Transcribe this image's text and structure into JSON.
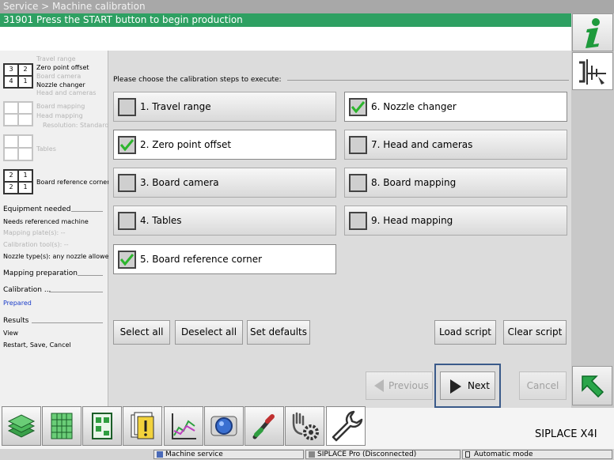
{
  "title": "Service > Machine calibration",
  "message": "31901 Press the START button to begin production",
  "instruction": "Please choose the calibration steps to execute:",
  "steps": [
    {
      "label": "1. Travel range",
      "checked": false
    },
    {
      "label": "2. Zero point offset",
      "checked": true
    },
    {
      "label": "3. Board camera",
      "checked": false
    },
    {
      "label": "4. Tables",
      "checked": false
    },
    {
      "label": "5. Board reference corner",
      "checked": true
    },
    {
      "label": "6. Nozzle changer",
      "checked": true
    },
    {
      "label": "7. Head and cameras",
      "checked": false
    },
    {
      "label": "8. Board mapping",
      "checked": false
    },
    {
      "label": "9. Head mapping",
      "checked": false
    }
  ],
  "buttons": {
    "select_all": "Select all",
    "deselect_all": "Deselect all",
    "set_defaults": "Set defaults",
    "load_script": "Load script",
    "clear_script": "Clear script",
    "previous": "Previous",
    "next": "Next",
    "cancel": "Cancel"
  },
  "left_panel": {
    "group1": [
      "Travel range",
      "Zero point offset",
      "Board camera",
      "Nozzle changer",
      "Head and cameras"
    ],
    "group1_grid": [
      "3",
      "2",
      "4",
      "1"
    ],
    "group2": [
      "Board mapping",
      "Head mapping",
      "Resolution: Standard"
    ],
    "group3": [
      "Tables"
    ],
    "group4": [
      "Board reference corner"
    ],
    "group4_grid": [
      "2",
      "1",
      "2",
      "1"
    ],
    "equipment_title": "Equipment needed",
    "equipment": [
      "Needs referenced machine",
      "Mapping plate(s): --",
      "Calibration tool(s): --",
      "Nozzle type(s): any nozzle allowed"
    ],
    "mapping_prep": "Mapping preparation",
    "calibration_title": "Calibration ...",
    "calibration_state": "Prepared",
    "results_title": "Results",
    "results": [
      "View",
      "Restart, Save, Cancel"
    ]
  },
  "brand": "SIPLACE X4I",
  "status": {
    "item1": "Machine service",
    "item2": "SIPLACE Pro (Disconnected)",
    "item3": "Automatic mode"
  },
  "colors": {
    "message_bar": "#2ea062",
    "check_green": "#2db52d",
    "highlight_border": "#3a5a8a",
    "prepared_blue": "#1a3cc8"
  }
}
